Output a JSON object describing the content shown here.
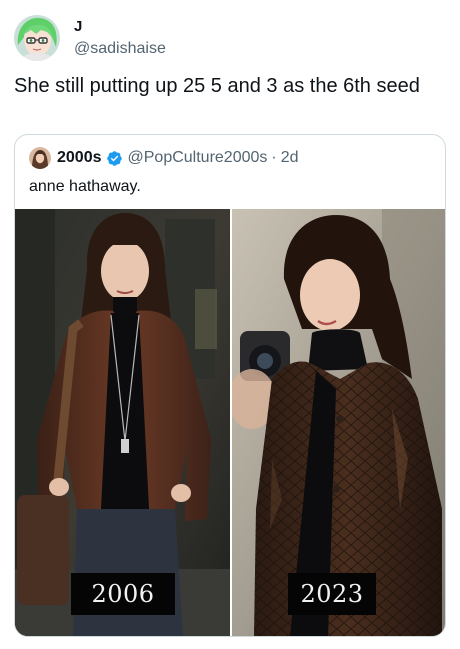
{
  "tweet": {
    "author": {
      "display_name": "J",
      "handle": "@sadishaise",
      "avatar_icon": "anime-avatar-icon"
    },
    "text": "She still putting up 25 5 and 3 as the 6th seed"
  },
  "quote": {
    "author": {
      "display_name": "2000s",
      "verified": true,
      "handle": "@PopCulture2000s",
      "separator": "·",
      "time": "2d"
    },
    "text": "anne hathaway.",
    "photos": [
      {
        "year_label": "2006"
      },
      {
        "year_label": "2023"
      }
    ]
  },
  "colors": {
    "text_primary": "#0f1419",
    "text_secondary": "#536471",
    "verified_blue": "#1d9bf0",
    "border": "#cfd9de"
  }
}
